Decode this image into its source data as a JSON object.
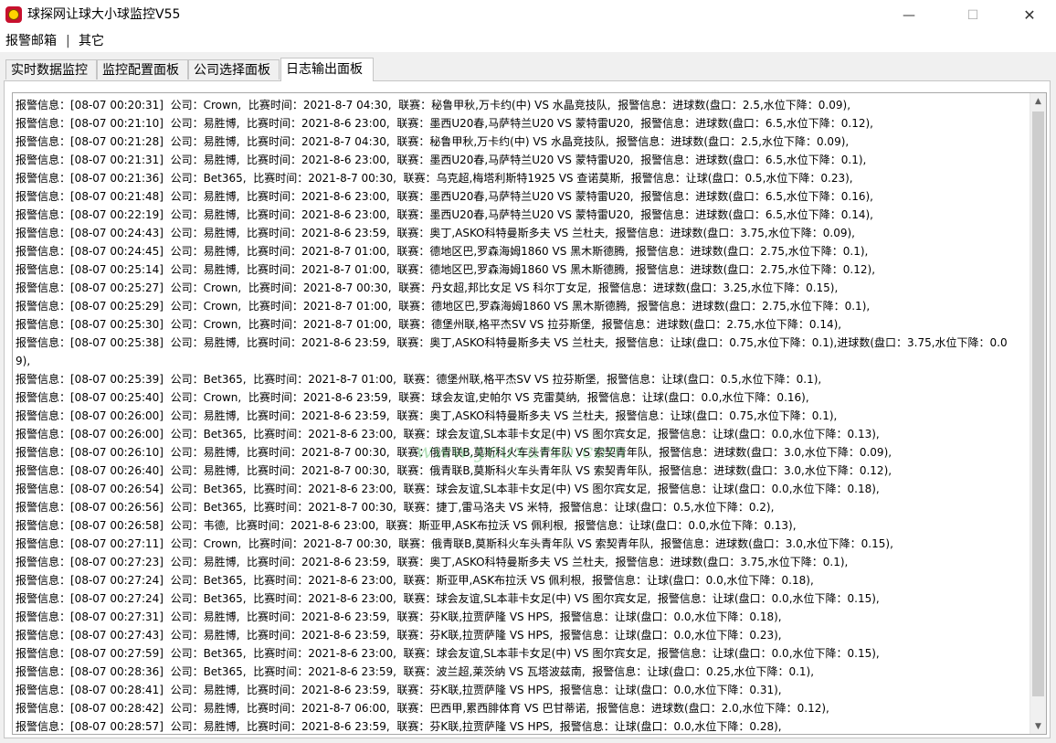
{
  "window": {
    "title": "球探网让球大小球监控V55",
    "minimize_symbol": "—",
    "maximize_symbol": "☐",
    "close_symbol": "✕"
  },
  "menu": {
    "item1": "报警邮箱",
    "separator": "|",
    "item2": "其它"
  },
  "tabs": [
    {
      "label": "实时数据监控"
    },
    {
      "label": "监控配置面板"
    },
    {
      "label": "公司选择面板"
    },
    {
      "label": "日志输出面板",
      "active": true
    }
  ],
  "watermark": "www.youxurso.com",
  "log_lines": [
    "报警信息：[08-07 00:20:31]  公司：Crown,  比赛时间：2021-8-7 04:30,  联赛：秘鲁甲秋,万卡约(中) VS 水晶竞技队,  报警信息：进球数(盘口：2.5,水位下降：0.09),",
    "报警信息：[08-07 00:21:10]  公司：易胜博,  比赛时间：2021-8-6 23:00,  联赛：墨西U20春,马萨特兰U20 VS 蒙特雷U20,  报警信息：进球数(盘口：6.5,水位下降：0.12),",
    "报警信息：[08-07 00:21:28]  公司：易胜博,  比赛时间：2021-8-7 04:30,  联赛：秘鲁甲秋,万卡约(中) VS 水晶竞技队,  报警信息：进球数(盘口：2.5,水位下降：0.09),",
    "报警信息：[08-07 00:21:31]  公司：易胜博,  比赛时间：2021-8-6 23:00,  联赛：墨西U20春,马萨特兰U20 VS 蒙特雷U20,  报警信息：进球数(盘口：6.5,水位下降：0.1),",
    "报警信息：[08-07 00:21:36]  公司：Bet365,  比赛时间：2021-8-7 00:30,  联赛：乌克超,梅塔利斯特1925 VS 查诺莫斯,  报警信息：让球(盘口：0.5,水位下降：0.23),",
    "报警信息：[08-07 00:21:48]  公司：易胜博,  比赛时间：2021-8-6 23:00,  联赛：墨西U20春,马萨特兰U20 VS 蒙特雷U20,  报警信息：进球数(盘口：6.5,水位下降：0.16),",
    "报警信息：[08-07 00:22:19]  公司：易胜博,  比赛时间：2021-8-6 23:00,  联赛：墨西U20春,马萨特兰U20 VS 蒙特雷U20,  报警信息：进球数(盘口：6.5,水位下降：0.14),",
    "报警信息：[08-07 00:24:43]  公司：易胜博,  比赛时间：2021-8-6 23:59,  联赛：奥丁,ASKO科特曼斯多夫 VS 兰杜夫,  报警信息：进球数(盘口：3.75,水位下降：0.09),",
    "报警信息：[08-07 00:24:45]  公司：易胜博,  比赛时间：2021-8-7 01:00,  联赛：德地区巴,罗森海姆1860 VS 黑木斯德腾,  报警信息：进球数(盘口：2.75,水位下降：0.1),",
    "报警信息：[08-07 00:25:14]  公司：易胜博,  比赛时间：2021-8-7 01:00,  联赛：德地区巴,罗森海姆1860 VS 黑木斯德腾,  报警信息：进球数(盘口：2.75,水位下降：0.12),",
    "报警信息：[08-07 00:25:27]  公司：Crown,  比赛时间：2021-8-7 00:30,  联赛：丹女超,邦比女足 VS 科尔丁女足,  报警信息：进球数(盘口：3.25,水位下降：0.15),",
    "报警信息：[08-07 00:25:29]  公司：Crown,  比赛时间：2021-8-7 01:00,  联赛：德地区巴,罗森海姆1860 VS 黑木斯德腾,  报警信息：进球数(盘口：2.75,水位下降：0.1),",
    "报警信息：[08-07 00:25:30]  公司：Crown,  比赛时间：2021-8-7 01:00,  联赛：德堡州联,格平杰SV VS 拉芬斯堡,  报警信息：进球数(盘口：2.75,水位下降：0.14),",
    "报警信息：[08-07 00:25:38]  公司：易胜博,  比赛时间：2021-8-6 23:59,  联赛：奥丁,ASKO科特曼斯多夫 VS 兰杜夫,  报警信息：让球(盘口：0.75,水位下降：0.1),进球数(盘口：3.75,水位下降：0.09),",
    "报警信息：[08-07 00:25:39]  公司：Bet365,  比赛时间：2021-8-7 01:00,  联赛：德堡州联,格平杰SV VS 拉芬斯堡,  报警信息：让球(盘口：0.5,水位下降：0.1),",
    "报警信息：[08-07 00:25:40]  公司：Crown,  比赛时间：2021-8-6 23:59,  联赛：球会友谊,史帕尔 VS 克雷莫纳,  报警信息：让球(盘口：0.0,水位下降：0.16),",
    "报警信息：[08-07 00:26:00]  公司：易胜博,  比赛时间：2021-8-6 23:59,  联赛：奥丁,ASKO科特曼斯多夫 VS 兰杜夫,  报警信息：让球(盘口：0.75,水位下降：0.1),",
    "报警信息：[08-07 00:26:00]  公司：Bet365,  比赛时间：2021-8-6 23:00,  联赛：球会友谊,SL本菲卡女足(中) VS 图尔宾女足,  报警信息：让球(盘口：0.0,水位下降：0.13),",
    "报警信息：[08-07 00:26:10]  公司：易胜博,  比赛时间：2021-8-7 00:30,  联赛：俄青联B,莫斯科火车头青年队 VS 索契青年队,  报警信息：进球数(盘口：3.0,水位下降：0.09),",
    "报警信息：[08-07 00:26:40]  公司：易胜博,  比赛时间：2021-8-7 00:30,  联赛：俄青联B,莫斯科火车头青年队 VS 索契青年队,  报警信息：进球数(盘口：3.0,水位下降：0.12),",
    "报警信息：[08-07 00:26:54]  公司：Bet365,  比赛时间：2021-8-6 23:00,  联赛：球会友谊,SL本菲卡女足(中) VS 图尔宾女足,  报警信息：让球(盘口：0.0,水位下降：0.18),",
    "报警信息：[08-07 00:26:56]  公司：Bet365,  比赛时间：2021-8-7 00:30,  联赛：捷丁,雷马洛夫 VS 米特,  报警信息：让球(盘口：0.5,水位下降：0.2),",
    "报警信息：[08-07 00:26:58]  公司：韦德,  比赛时间：2021-8-6 23:00,  联赛：斯亚甲,ASK布拉沃 VS 佩利根,  报警信息：让球(盘口：0.0,水位下降：0.13),",
    "报警信息：[08-07 00:27:11]  公司：Crown,  比赛时间：2021-8-7 00:30,  联赛：俄青联B,莫斯科火车头青年队 VS 索契青年队,  报警信息：进球数(盘口：3.0,水位下降：0.15),",
    "报警信息：[08-07 00:27:23]  公司：易胜博,  比赛时间：2021-8-6 23:59,  联赛：奥丁,ASKO科特曼斯多夫 VS 兰杜夫,  报警信息：进球数(盘口：3.75,水位下降：0.1),",
    "报警信息：[08-07 00:27:24]  公司：Bet365,  比赛时间：2021-8-6 23:00,  联赛：斯亚甲,ASK布拉沃 VS 佩利根,  报警信息：让球(盘口：0.0,水位下降：0.18),",
    "报警信息：[08-07 00:27:24]  公司：Bet365,  比赛时间：2021-8-6 23:00,  联赛：球会友谊,SL本菲卡女足(中) VS 图尔宾女足,  报警信息：让球(盘口：0.0,水位下降：0.15),",
    "报警信息：[08-07 00:27:31]  公司：易胜博,  比赛时间：2021-8-6 23:59,  联赛：芬K联,拉贾萨隆 VS HPS,  报警信息：让球(盘口：0.0,水位下降：0.18),",
    "报警信息：[08-07 00:27:43]  公司：易胜博,  比赛时间：2021-8-6 23:59,  联赛：芬K联,拉贾萨隆 VS HPS,  报警信息：让球(盘口：0.0,水位下降：0.23),",
    "报警信息：[08-07 00:27:59]  公司：Bet365,  比赛时间：2021-8-6 23:00,  联赛：球会友谊,SL本菲卡女足(中) VS 图尔宾女足,  报警信息：让球(盘口：0.0,水位下降：0.15),",
    "报警信息：[08-07 00:28:36]  公司：Bet365,  比赛时间：2021-8-6 23:59,  联赛：波兰超,莱茨纳 VS 瓦塔波兹南,  报警信息：让球(盘口：0.25,水位下降：0.1),",
    "报警信息：[08-07 00:28:41]  公司：易胜博,  比赛时间：2021-8-6 23:59,  联赛：芬K联,拉贾萨隆 VS HPS,  报警信息：让球(盘口：0.0,水位下降：0.31),",
    "报警信息：[08-07 00:28:42]  公司：易胜博,  比赛时间：2021-8-7 06:00,  联赛：巴西甲,累西腓体育 VS 巴甘蒂诺,  报警信息：进球数(盘口：2.0,水位下降：0.12),",
    "报警信息：[08-07 00:28:57]  公司：易胜博,  比赛时间：2021-8-6 23:59,  联赛：芬K联,拉贾萨隆 VS HPS,  报警信息：让球(盘口：0.0,水位下降：0.28),"
  ]
}
